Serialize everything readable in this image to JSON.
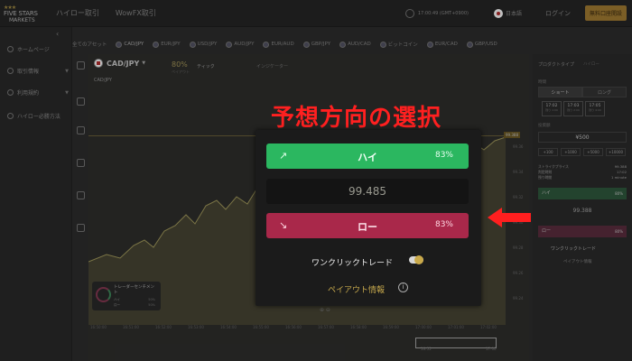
{
  "header": {
    "logo_top": "FIVE STARS",
    "logo_bottom": "MARKETS",
    "nav": [
      "ハイロー取引",
      "WowFX取引"
    ],
    "clock": "17:00:49 (GMT+0900)",
    "language": "日本語",
    "login": "ログイン",
    "open_account": "無料口座開設"
  },
  "sidebar": {
    "items": [
      {
        "label": "ホームページ",
        "icon": "home-icon"
      },
      {
        "label": "取引情報",
        "icon": "info-icon"
      },
      {
        "label": "利用規約",
        "icon": "terms-icon"
      },
      {
        "label": "ハイロー必勝方法",
        "icon": "help-icon"
      }
    ]
  },
  "assets": [
    "全てのアセット",
    "CAD/JPY",
    "EUR/JPY",
    "USD/JPY",
    "AUD/JPY",
    "EUR/AUD",
    "GBP/JPY",
    "AUD/CAD",
    "ビットコイン",
    "EUR/CAD",
    "GBP/USD"
  ],
  "chart": {
    "pair": "CAD/JPY",
    "payout": "80%",
    "payout_sub": "ペイアウト",
    "tick": "ティック",
    "indicator": "インジケーター",
    "symbol": "CAD/JPY",
    "current_price": "99.388",
    "y_ticks": [
      "99.388",
      "99.36",
      "99.34",
      "99.32",
      "99.30",
      "99.28",
      "99.26",
      "99.24",
      "99.22",
      "99.20"
    ],
    "x_ticks": [
      "16:50:00",
      "16:51:00",
      "16:52:00",
      "16:53:00",
      "16:54:00",
      "16:55:00",
      "16:56:00",
      "16:57:00",
      "16:58:00",
      "16:59:00",
      "17:00:00",
      "17:01:00",
      "17:02:00"
    ]
  },
  "sentiment": {
    "title": "トレーダーセンチメント",
    "high_label": "ハイ",
    "high_value": "50%",
    "low_label": "ロー",
    "low_value": "50%"
  },
  "minimap": {
    "start": "16:55",
    "end": "17:00"
  },
  "panel": {
    "title": "プロダクトタイプ",
    "subtitle": "ハイロー",
    "time_label": "時間",
    "tabs": [
      "ショート",
      "ロング"
    ],
    "times": [
      {
        "time": "17:02",
        "sub": "残り 1:09"
      },
      {
        "time": "17:03",
        "sub": "残り 2:09"
      },
      {
        "time": "17:05",
        "sub": "残り 4:09"
      }
    ],
    "amount_label": "投資額",
    "amount": "¥500",
    "quick": [
      "+100",
      "+1000",
      "+5000",
      "+10000"
    ],
    "strike_label": "ストライクプライス",
    "strike_value": "99.388",
    "expiry_label": "判定時刻",
    "expiry_value": "17:02",
    "remain_label": "残り時間",
    "remain_value": "1 minute",
    "high_label": "ハイ",
    "high_pct": "80%",
    "price": "99.388",
    "low_label": "ロー",
    "low_pct": "80%",
    "oneclick": "ワンクリックトレード",
    "payout": "ペイアウト情報"
  },
  "annotation": {
    "title": "予想方向の選択",
    "color": "#ff2020"
  },
  "popup": {
    "high_label": "ハイ",
    "high_pct": "83%",
    "price": "99.485",
    "low_label": "ロー",
    "low_pct": "83%",
    "oneclick": "ワンクリックトレード",
    "payout": "ペイアウト情報",
    "high_color": "#2bb760",
    "low_color": "#a9284a"
  }
}
